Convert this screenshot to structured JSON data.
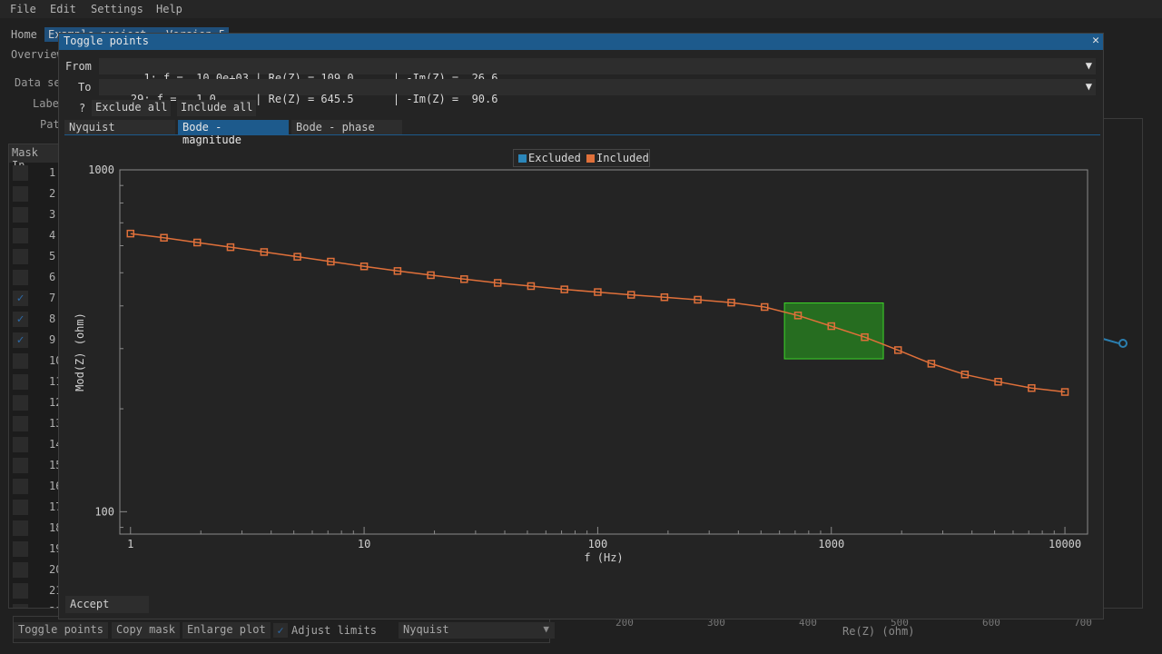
{
  "menu": [
    "File",
    "Edit",
    "Settings",
    "Help"
  ],
  "bg_tabs": [
    "Home",
    "Ex"
  ],
  "bg_tabs_tail": "ample project - Version 5",
  "bg_subtab": "Overview",
  "bg_labels": [
    "Data se",
    "Labe",
    "Pat"
  ],
  "bg_table": {
    "headers": [
      "Mask",
      "In"
    ],
    "row_numbers": [
      "1",
      "2",
      "3",
      "4",
      "5",
      "6",
      "7",
      "8",
      "9",
      "10",
      "11",
      "12",
      "13",
      "14",
      "15",
      "16",
      "17",
      "18",
      "19",
      "20",
      "21",
      "22"
    ],
    "checked": [
      7,
      8,
      9
    ]
  },
  "bg_bottom": {
    "toggle_points": "Toggle points",
    "copy_mask": "Copy mask",
    "enlarge_plot": "Enlarge plot",
    "adjust_limits": "Adjust limits",
    "plot_type": "Nyquist"
  },
  "bg_plot": {
    "xlabel": "Re(Z) (ohm)",
    "tick_labels": [
      "200",
      "300",
      "400",
      "500",
      "600",
      "700"
    ]
  },
  "modal": {
    "title": "Toggle points",
    "close_icon": "close-icon",
    "from_label": "From",
    "from_value": "  1: f =  10.0e+03 | Re(Z) = 109.0      | -Im(Z) =  26.6",
    "to_label": "To",
    "to_value": "29: f =   1.0      | Re(Z) = 645.5      | -Im(Z) =  90.6",
    "help": "?",
    "exclude_all": "Exclude all",
    "include_all": "Include all",
    "tabs": [
      "Nyquist",
      "Bode - magnitude",
      "Bode - phase"
    ],
    "active_tab": 1,
    "accept": "Accept"
  },
  "chart_data": {
    "type": "line",
    "xlabel": "f (Hz)",
    "ylabel": "Mod(Z) (ohm)",
    "x_scale": "log",
    "y_scale": "log",
    "xlim": [
      0.9,
      12500
    ],
    "ylim": [
      86,
      1000
    ],
    "x_ticks": [
      1,
      10,
      100,
      1000,
      10000
    ],
    "x_tick_labels": [
      "1",
      "10",
      "100",
      "1000",
      "10000"
    ],
    "y_ticks": [
      100,
      1000
    ],
    "y_tick_labels": [
      "100",
      "1000"
    ],
    "legend": [
      "Excluded",
      "Included"
    ],
    "legend_colors": {
      "Excluded": "#2b86b9",
      "Included": "#e0703a"
    },
    "selection": {
      "x_range": [
        630,
        1670
      ],
      "y_range": [
        280,
        408
      ]
    },
    "series": [
      {
        "name": "Included",
        "color": "#e0703a",
        "x": [
          1.0,
          1.39,
          1.93,
          2.68,
          3.73,
          5.18,
          7.2,
          10.0,
          13.9,
          19.3,
          26.8,
          37.3,
          51.8,
          72.0,
          100.0,
          139,
          193,
          268,
          373,
          518,
          720,
          1000,
          1390,
          1930,
          2680,
          3730,
          5180,
          7200,
          10000
        ],
        "values": [
          651,
          633,
          613,
          594,
          575,
          557,
          539,
          522,
          506,
          492,
          479,
          467,
          457,
          447,
          439,
          431,
          424,
          417,
          409,
          397,
          375,
          349,
          324,
          297,
          271,
          252,
          240,
          230,
          224
        ]
      }
    ]
  }
}
